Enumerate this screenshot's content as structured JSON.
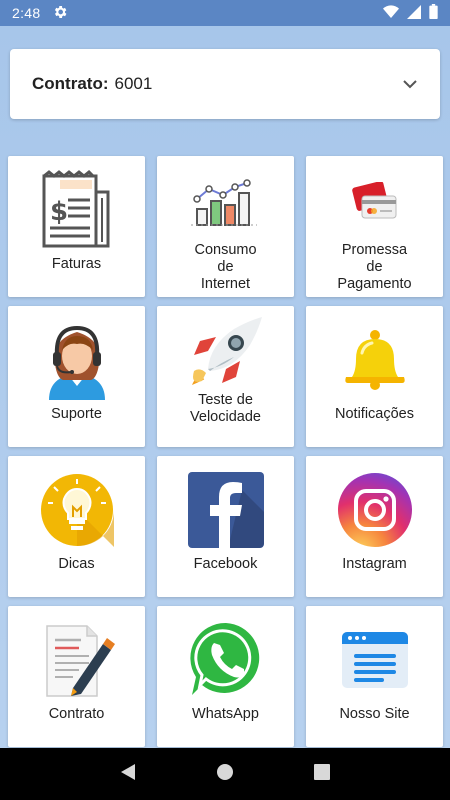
{
  "status_bar": {
    "time": "2:48"
  },
  "contract": {
    "label": "Contrato:",
    "value": "6001"
  },
  "tiles": [
    {
      "label": "Faturas",
      "icon": "invoice-icon"
    },
    {
      "label": "Consumo\nde\nInternet",
      "icon": "chart-icon"
    },
    {
      "label": "Promessa\nde\nPagamento",
      "icon": "cards-icon"
    },
    {
      "label": "Suporte",
      "icon": "support-agent-icon"
    },
    {
      "label": "Teste de\nVelocidade",
      "icon": "rocket-icon"
    },
    {
      "label": "Notificações",
      "icon": "bell-icon"
    },
    {
      "label": "Dicas",
      "icon": "lightbulb-icon"
    },
    {
      "label": "Facebook",
      "icon": "facebook-icon"
    },
    {
      "label": "Instagram",
      "icon": "instagram-icon"
    },
    {
      "label": "Contrato",
      "icon": "document-pen-icon"
    },
    {
      "label": "WhatsApp",
      "icon": "whatsapp-icon"
    },
    {
      "label": "Nosso Site",
      "icon": "website-icon"
    }
  ],
  "colors": {
    "status_bar": "#5b86c4",
    "background": "#a9c9ea",
    "card": "#ffffff",
    "facebook": "#3b5998",
    "whatsapp": "#2fb742",
    "bell": "#f5d10b",
    "tips": "#f2b705"
  }
}
